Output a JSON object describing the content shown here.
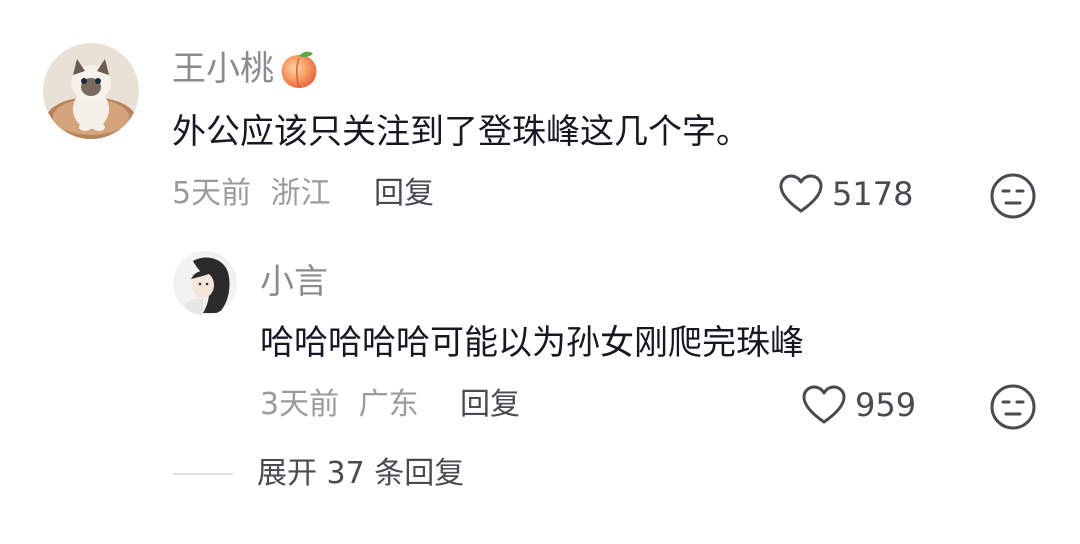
{
  "comments": [
    {
      "username": "王小桃",
      "username_emoji": "peach-emoji",
      "text": "外公应该只关注到了登珠峰这几个字。",
      "time": "5天前",
      "location": "浙江",
      "reply_label": "回复",
      "likes": "5178",
      "avatar": "cat-avatar",
      "replies": [
        {
          "username": "小言",
          "text": "哈哈哈哈哈可能以为孙女刚爬完珠峰",
          "time": "3天前",
          "location": "广东",
          "reply_label": "回复",
          "likes": "959",
          "avatar": "girl-avatar"
        }
      ],
      "expand_label": "展开 37 条回复"
    }
  ],
  "colors": {
    "text_primary": "#161823",
    "text_secondary": "#8a8a8f",
    "icon_stroke": "#4a4a52"
  }
}
